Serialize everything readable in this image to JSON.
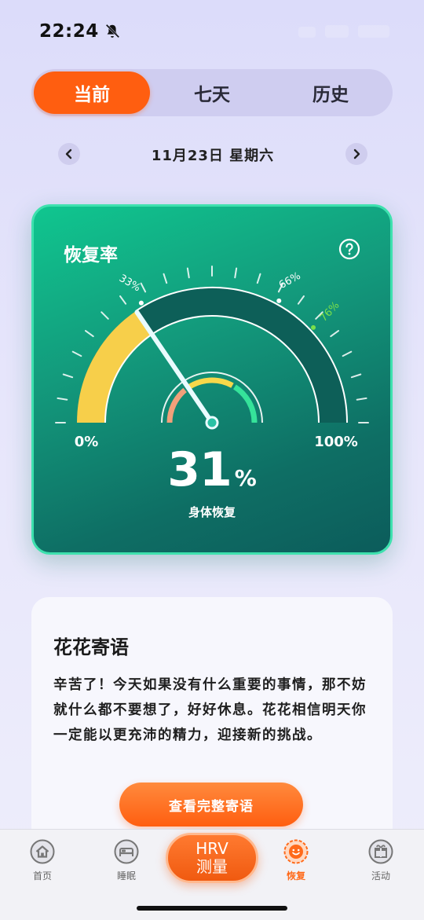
{
  "status_bar": {
    "time": "22:24"
  },
  "tabs": [
    {
      "label": "当前",
      "active": true
    },
    {
      "label": "七天",
      "active": false
    },
    {
      "label": "历史",
      "active": false
    }
  ],
  "date": {
    "text": "11月23日  星期六"
  },
  "recovery_card": {
    "title": "恢复率",
    "gauge": {
      "value_percent": 31,
      "min_label": "0%",
      "max_label": "100%",
      "markers": [
        {
          "label": "33%",
          "value": 33
        },
        {
          "label": "66%",
          "value": 66
        },
        {
          "label": "76%",
          "value": 76
        }
      ]
    },
    "value_number": "31",
    "value_unit": "%",
    "subtitle": "身体恢复"
  },
  "message_card": {
    "title": "花花寄语",
    "body": "辛苦了！今天如果没有什么重要的事情，那不妨就什么都不要想了，好好休息。花花相信明天你一定能以更充沛的精力，迎接新的挑战。",
    "button_label": "查看完整寄语"
  },
  "tabbar": {
    "items": [
      {
        "label": "首页",
        "icon": "home-icon",
        "active": false
      },
      {
        "label": "睡眠",
        "icon": "bed-icon",
        "active": false
      },
      {
        "label": "恢复",
        "icon": "recovery-icon",
        "active": true
      },
      {
        "label": "活动",
        "icon": "gift-icon",
        "active": false
      }
    ],
    "center_button": {
      "line1": "HRV",
      "line2": "测量"
    }
  },
  "colors": {
    "accent": "#ff5e10",
    "card_green": "#139a7c",
    "gauge_yellow": "#f7cf4a",
    "marker_green": "#7be04a"
  }
}
